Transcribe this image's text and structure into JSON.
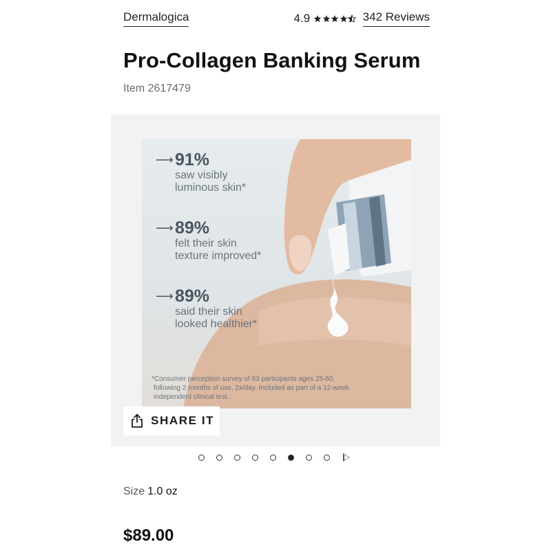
{
  "header": {
    "brand": "Dermalogica",
    "rating_value": "4.9",
    "rating_stars": 4.5,
    "reviews_label": "342 Reviews"
  },
  "product": {
    "title": "Pro-Collagen Banking Serum",
    "item_label": "Item 2617479"
  },
  "gallery": {
    "stats": [
      {
        "arrow": "⟶",
        "percent": "91%",
        "line1": "saw visibly",
        "line2": "luminous skin*"
      },
      {
        "arrow": "⟶",
        "percent": "89%",
        "line1": "felt their skin",
        "line2": "texture improved*"
      },
      {
        "arrow": "⟶",
        "percent": "89%",
        "line1": "said their skin",
        "line2": "looked healthier*"
      }
    ],
    "footnote_line1": "*Consumer perception survey of 63 participants ages 25-60,",
    "footnote_line2": "following 2 months of use, 2x/day. Included as part of a 12-week",
    "footnote_line3": "independent clinical test.",
    "share_label": "SHARE IT",
    "pagination": {
      "total": 8,
      "active_index": 5
    }
  },
  "details": {
    "size_label": "Size",
    "size_value": "1.0 oz",
    "price": "$89.00"
  },
  "icons": {
    "share": "share-icon",
    "star": "star-icon",
    "next": "next-arrow-icon"
  }
}
